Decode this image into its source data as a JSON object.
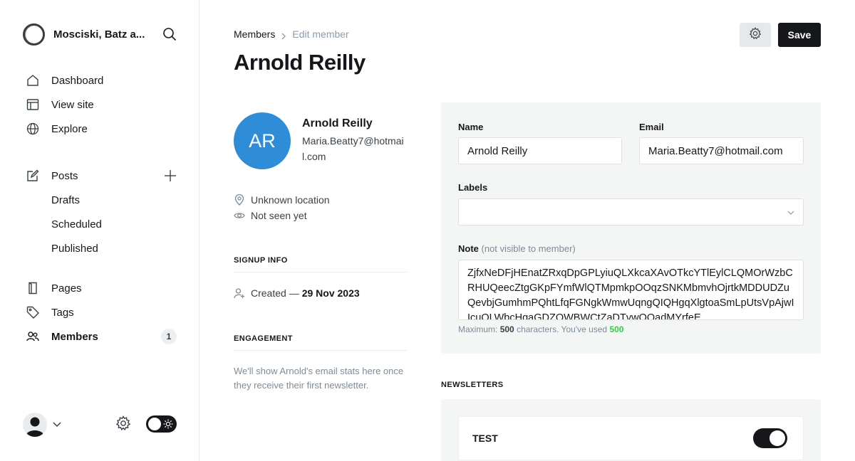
{
  "site": {
    "title": "Mosciski, Batz a..."
  },
  "sidebar": {
    "items": [
      {
        "label": "Dashboard",
        "icon": "home-icon"
      },
      {
        "label": "View site",
        "icon": "layout-icon"
      },
      {
        "label": "Explore",
        "icon": "globe-icon"
      }
    ],
    "posts": {
      "label": "Posts",
      "icon": "edit-icon",
      "sub": [
        "Drafts",
        "Scheduled",
        "Published"
      ]
    },
    "items2": [
      {
        "label": "Pages",
        "icon": "page-icon"
      },
      {
        "label": "Tags",
        "icon": "tag-icon"
      },
      {
        "label": "Members",
        "icon": "members-icon",
        "count": "1"
      }
    ]
  },
  "breadcrumb": {
    "parent": "Members",
    "current": "Edit member"
  },
  "page": {
    "title": "Arnold Reilly"
  },
  "toolbar": {
    "save_label": "Save"
  },
  "member": {
    "initials": "AR",
    "name": "Arnold Reilly",
    "email": "Maria.Beatty7@hotmail.com",
    "location": "Unknown location",
    "seen": "Not seen yet",
    "avatar_color": "#2f8dd8"
  },
  "signup": {
    "heading": "SIGNUP INFO",
    "created_prefix": "Created —",
    "created_date": "29 Nov 2023"
  },
  "engagement": {
    "heading": "ENGAGEMENT",
    "text": "We'll show Arnold's email stats here once they receive their first newsletter."
  },
  "form": {
    "name_label": "Name",
    "name_value": "Arnold Reilly",
    "email_label": "Email",
    "email_value": "Maria.Beatty7@hotmail.com",
    "labels_label": "Labels",
    "note_label": "Note",
    "note_hint": "(not visible to member)",
    "note_value": "ZjfxNeDFjHEnatZRxqDpGPLyiuQLXkcaXAvOTkcYTlEylCLQMOrWzbCRHUQeecZtgGKpFYmfWlQTMpmkpOOqzSNKMbmvhOjrtkMDDUDZuQevbjGumhmPQhtLfqFGNgkWmwUqngQIQHgqXlgtoaSmLpUtsVpAjwIIcuOLWbcHqaGDZOWBWCtZaDTvwOQadMYrfeE",
    "count_prefix": "Maximum:",
    "count_max": "500",
    "count_mid": "characters. You've used",
    "count_used": "500"
  },
  "newsletters": {
    "heading": "NEWSLETTERS",
    "items": [
      {
        "name": "TEST",
        "subscribed": true
      }
    ]
  },
  "colors": {
    "accent": "#15171a",
    "success": "#30cf43",
    "panel": "#f4f5f5"
  }
}
